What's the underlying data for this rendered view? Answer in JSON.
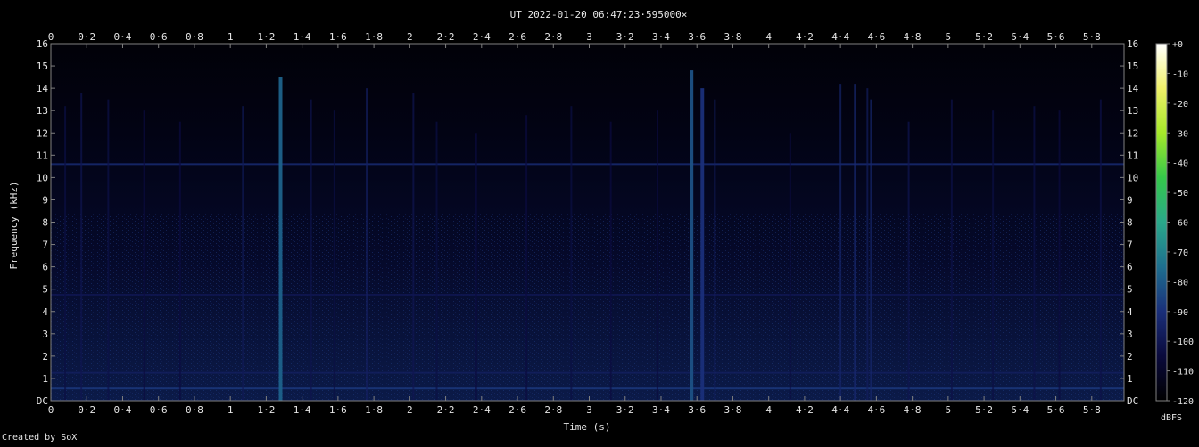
{
  "chart_data": {
    "type": "heatmap",
    "title": "UT 2022-01-20 06:47:23·595000×",
    "xlabel": "Time (s)",
    "ylabel": "Frequency (kHz)",
    "xlim": [
      0,
      5.98
    ],
    "ylim": [
      0,
      16
    ],
    "x_ticks": [
      {
        "v": 0,
        "label": "0"
      },
      {
        "v": 0.2,
        "label": "0·2"
      },
      {
        "v": 0.4,
        "label": "0·4"
      },
      {
        "v": 0.6,
        "label": "0·6"
      },
      {
        "v": 0.8,
        "label": "0·8"
      },
      {
        "v": 1,
        "label": "1"
      },
      {
        "v": 1.2,
        "label": "1·2"
      },
      {
        "v": 1.4,
        "label": "1·4"
      },
      {
        "v": 1.6,
        "label": "1·6"
      },
      {
        "v": 1.8,
        "label": "1·8"
      },
      {
        "v": 2,
        "label": "2"
      },
      {
        "v": 2.2,
        "label": "2·2"
      },
      {
        "v": 2.4,
        "label": "2·4"
      },
      {
        "v": 2.6,
        "label": "2·6"
      },
      {
        "v": 2.8,
        "label": "2·8"
      },
      {
        "v": 3,
        "label": "3"
      },
      {
        "v": 3.2,
        "label": "3·2"
      },
      {
        "v": 3.4,
        "label": "3·4"
      },
      {
        "v": 3.6,
        "label": "3·6"
      },
      {
        "v": 3.8,
        "label": "3·8"
      },
      {
        "v": 4,
        "label": "4"
      },
      {
        "v": 4.2,
        "label": "4·2"
      },
      {
        "v": 4.4,
        "label": "4·4"
      },
      {
        "v": 4.6,
        "label": "4·6"
      },
      {
        "v": 4.8,
        "label": "4·8"
      },
      {
        "v": 5,
        "label": "5"
      },
      {
        "v": 5.2,
        "label": "5·2"
      },
      {
        "v": 5.4,
        "label": "5·4"
      },
      {
        "v": 5.6,
        "label": "5·6"
      },
      {
        "v": 5.8,
        "label": "5·8"
      }
    ],
    "y_ticks": [
      {
        "v": 0,
        "label": "DC"
      },
      {
        "v": 1,
        "label": "1"
      },
      {
        "v": 2,
        "label": "2"
      },
      {
        "v": 3,
        "label": "3"
      },
      {
        "v": 4,
        "label": "4"
      },
      {
        "v": 5,
        "label": "5"
      },
      {
        "v": 6,
        "label": "6"
      },
      {
        "v": 7,
        "label": "7"
      },
      {
        "v": 8,
        "label": "8"
      },
      {
        "v": 9,
        "label": "9"
      },
      {
        "v": 10,
        "label": "10"
      },
      {
        "v": 11,
        "label": "11"
      },
      {
        "v": 12,
        "label": "12"
      },
      {
        "v": 13,
        "label": "13"
      },
      {
        "v": 14,
        "label": "14"
      },
      {
        "v": 15,
        "label": "15"
      },
      {
        "v": 16,
        "label": "16"
      }
    ],
    "colorbar": {
      "unit": "dBFS",
      "range": [
        -120,
        0
      ],
      "ticks": [
        {
          "v": 0,
          "label": "+0"
        },
        {
          "v": -10,
          "label": "-10"
        },
        {
          "v": -20,
          "label": "-20"
        },
        {
          "v": -30,
          "label": "-30"
        },
        {
          "v": -40,
          "label": "-40"
        },
        {
          "v": -50,
          "label": "-50"
        },
        {
          "v": -60,
          "label": "-60"
        },
        {
          "v": -70,
          "label": "-70"
        },
        {
          "v": -80,
          "label": "-80"
        },
        {
          "v": -90,
          "label": "-90"
        },
        {
          "v": -100,
          "label": "-100"
        },
        {
          "v": -110,
          "label": "-110"
        },
        {
          "v": -120,
          "label": "-120"
        }
      ],
      "colors": [
        "#000000",
        "#0a0a3c",
        "#1a2f7a",
        "#1e6f8f",
        "#2aa88a",
        "#35c84a",
        "#a6e82a",
        "#f0f06a",
        "#ffffff"
      ]
    },
    "horizontal_lines": [
      {
        "freq_khz": 10.6,
        "level_db": -92
      },
      {
        "freq_khz": 4.75,
        "level_db": -100
      },
      {
        "freq_khz": 1.25,
        "level_db": -97
      },
      {
        "freq_khz": 0.55,
        "level_db": -88
      }
    ],
    "vertical_events": [
      {
        "t": 0.08,
        "f_top": 13.2,
        "level_db": -103
      },
      {
        "t": 0.17,
        "f_top": 13.8,
        "level_db": -100
      },
      {
        "t": 0.32,
        "f_top": 13.5,
        "level_db": -102
      },
      {
        "t": 0.52,
        "f_top": 13.0,
        "level_db": -104
      },
      {
        "t": 0.72,
        "f_top": 12.5,
        "level_db": -104
      },
      {
        "t": 1.07,
        "f_top": 13.2,
        "level_db": -99
      },
      {
        "t": 1.28,
        "f_top": 14.5,
        "level_db": -78
      },
      {
        "t": 1.45,
        "f_top": 13.5,
        "level_db": -101
      },
      {
        "t": 1.58,
        "f_top": 13.0,
        "level_db": -103
      },
      {
        "t": 1.76,
        "f_top": 14.0,
        "level_db": -96
      },
      {
        "t": 2.02,
        "f_top": 13.8,
        "level_db": -100
      },
      {
        "t": 2.15,
        "f_top": 12.5,
        "level_db": -103
      },
      {
        "t": 2.37,
        "f_top": 12.0,
        "level_db": -104
      },
      {
        "t": 2.65,
        "f_top": 12.8,
        "level_db": -104
      },
      {
        "t": 2.9,
        "f_top": 13.2,
        "level_db": -103
      },
      {
        "t": 3.12,
        "f_top": 12.5,
        "level_db": -104
      },
      {
        "t": 3.38,
        "f_top": 13.0,
        "level_db": -104
      },
      {
        "t": 3.57,
        "f_top": 14.8,
        "level_db": -82
      },
      {
        "t": 3.63,
        "f_top": 14.0,
        "level_db": -90
      },
      {
        "t": 3.7,
        "f_top": 13.5,
        "level_db": -96
      },
      {
        "t": 4.12,
        "f_top": 12.0,
        "level_db": -104
      },
      {
        "t": 4.4,
        "f_top": 14.2,
        "level_db": -94
      },
      {
        "t": 4.48,
        "f_top": 14.2,
        "level_db": -92
      },
      {
        "t": 4.55,
        "f_top": 14.0,
        "level_db": -97
      },
      {
        "t": 4.57,
        "f_top": 13.5,
        "level_db": -93
      },
      {
        "t": 4.78,
        "f_top": 12.5,
        "level_db": -100
      },
      {
        "t": 5.02,
        "f_top": 13.5,
        "level_db": -102
      },
      {
        "t": 5.25,
        "f_top": 13.0,
        "level_db": -103
      },
      {
        "t": 5.48,
        "f_top": 13.2,
        "level_db": -102
      },
      {
        "t": 5.62,
        "f_top": 13.0,
        "level_db": -104
      },
      {
        "t": 5.85,
        "f_top": 13.5,
        "level_db": -102
      }
    ],
    "footer": "Created by SoX"
  }
}
